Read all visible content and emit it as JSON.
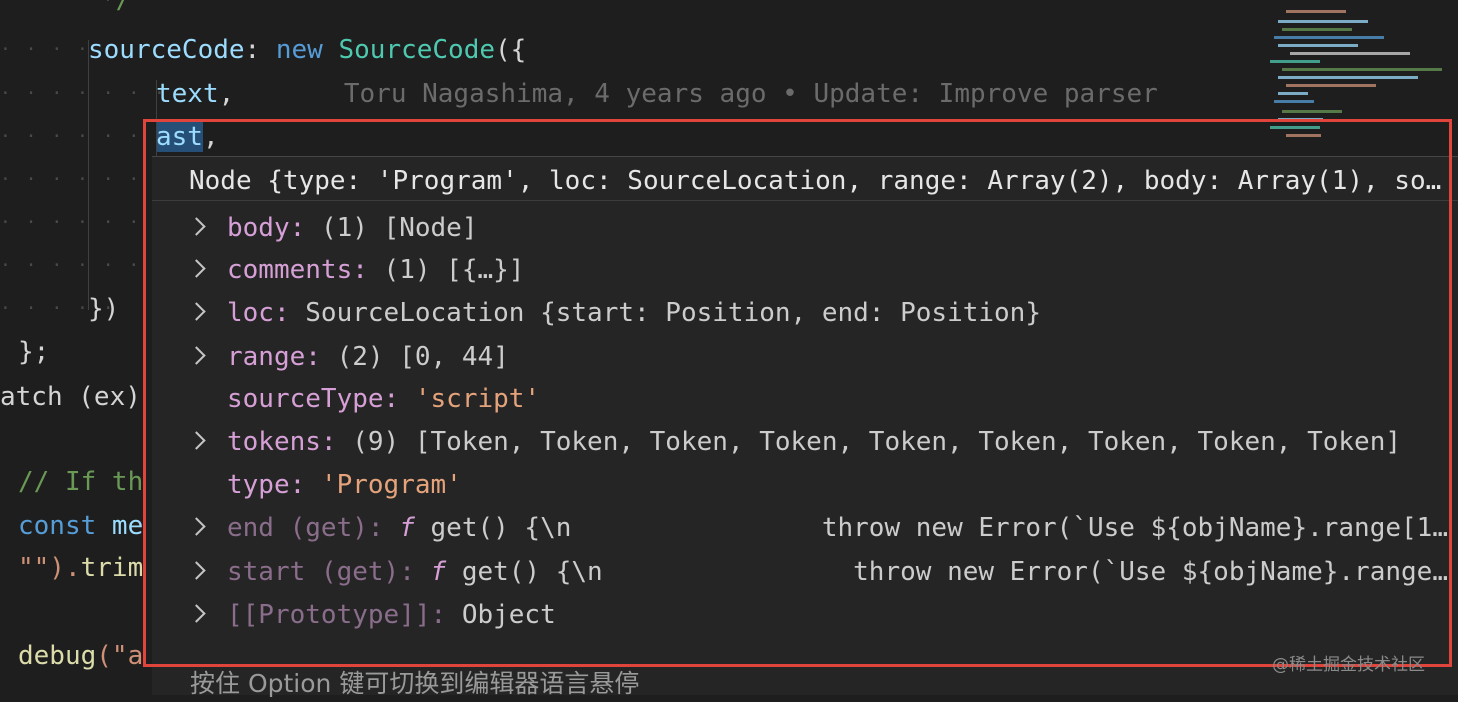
{
  "editor": {
    "lines": [
      {
        "parts": [
          {
            "t": "*/",
            "c": "cmt"
          }
        ]
      },
      {
        "parts": [
          {
            "t": "sourceCode",
            "c": "prop"
          },
          {
            "t": ": ",
            "c": ""
          },
          {
            "t": "new",
            "c": "kw"
          },
          {
            "t": " ",
            "c": ""
          },
          {
            "t": "SourceCode",
            "c": "cls"
          },
          {
            "t": "({",
            "c": ""
          }
        ]
      },
      {
        "parts": [
          {
            "t": "text",
            "c": "prop"
          },
          {
            "t": ",",
            "c": ""
          }
        ]
      },
      {
        "parts": [
          {
            "t": "ast",
            "c": "prop"
          },
          {
            "t": ",",
            "c": ""
          }
        ]
      },
      {
        "parts": []
      },
      {
        "parts": []
      },
      {
        "parts": []
      },
      {
        "parts": [
          {
            "t": "})",
            "c": ""
          }
        ]
      },
      {
        "parts": [
          {
            "t": "};",
            "c": ""
          }
        ]
      },
      {
        "parts": [
          {
            "t": "atch (ex)",
            "c": ""
          }
        ]
      },
      {
        "parts": []
      },
      {
        "parts": [
          {
            "t": "// If th",
            "c": "cmt"
          }
        ]
      },
      {
        "parts": [
          {
            "t": "const",
            "c": "kw"
          },
          {
            "t": " me",
            "c": "prop"
          }
        ]
      },
      {
        "parts": [
          {
            "t": "\"\").",
            "c": "str"
          },
          {
            "t": "trim",
            "c": "fn"
          }
        ]
      },
      {
        "parts": []
      },
      {
        "parts": [
          {
            "t": "debug",
            "c": "fn"
          },
          {
            "t": "(\"a",
            "c": "str"
          }
        ]
      }
    ],
    "blame": "Toru Nagashima, 4 years ago • Update: Improve parser"
  },
  "hover": {
    "header": "Node {type: 'Program', loc: SourceLocation, range: Array(2), body: Array(1), so…",
    "rows": [
      {
        "expandable": true,
        "key": "body",
        "dim": false,
        "value": "(1) [Node]",
        "vtype": "plain"
      },
      {
        "expandable": true,
        "key": "comments",
        "dim": false,
        "value": "(1) [{…}]",
        "vtype": "plain"
      },
      {
        "expandable": true,
        "key": "loc",
        "dim": false,
        "value": "SourceLocation {start: Position, end: Position}",
        "vtype": "plain"
      },
      {
        "expandable": true,
        "key": "range",
        "dim": false,
        "value": "(2) [0, 44]",
        "vtype": "plain"
      },
      {
        "expandable": false,
        "key": "sourceType",
        "dim": false,
        "value": "'script'",
        "vtype": "string"
      },
      {
        "expandable": true,
        "key": "tokens",
        "dim": false,
        "value": "(9) [Token, Token, Token, Token, Token, Token, Token, Token, Token]",
        "vtype": "plain"
      },
      {
        "expandable": false,
        "key": "type",
        "dim": false,
        "value": "'Program'",
        "vtype": "string"
      },
      {
        "expandable": true,
        "key": "end (get)",
        "dim": true,
        "value": "get() {\\n                throw new Error(`Use ${objName}.range[1…",
        "vtype": "function"
      },
      {
        "expandable": true,
        "key": "start (get)",
        "dim": true,
        "value": "get() {\\n                throw new Error(`Use ${objName}.range…",
        "vtype": "function"
      },
      {
        "expandable": true,
        "key": "[[Prototype]]",
        "dim": true,
        "value": "Object",
        "vtype": "plain"
      }
    ],
    "function_glyph": "f",
    "footer": "按住 Option 键可切换到编辑器语言悬停"
  },
  "watermark": "@稀土掘金技术社区",
  "colors": {
    "editor_bg": "#1e1e1e",
    "hover_bg": "#252526",
    "highlight_box": "#e0443a",
    "property_key": "#d6a0d6",
    "string_value": "#e4a37b"
  }
}
